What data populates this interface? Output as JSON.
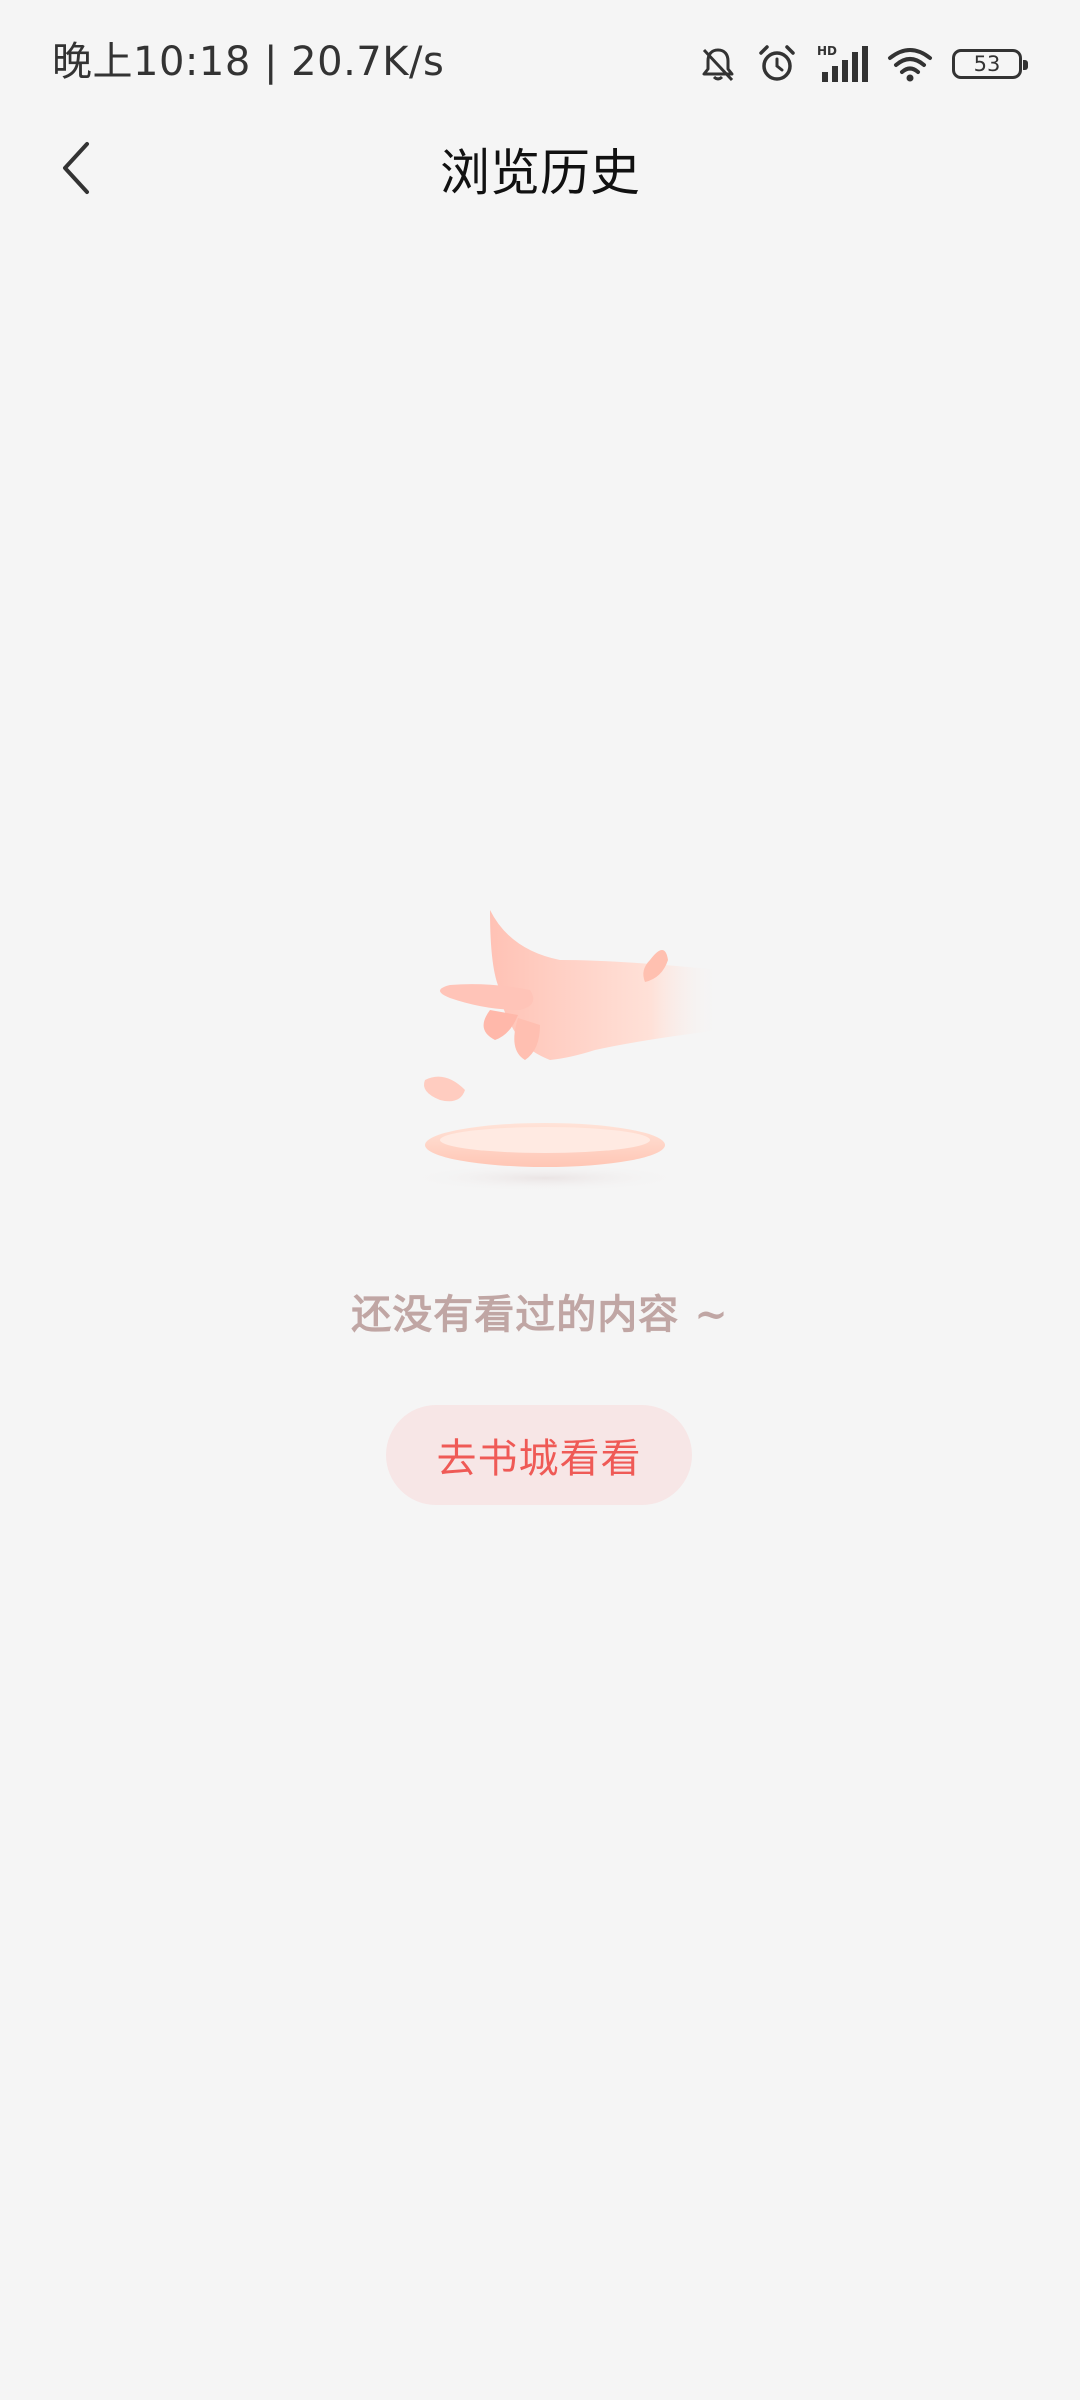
{
  "status_bar": {
    "time_text": "晚上10:18 | 20.7K/s",
    "battery_level": "53",
    "icons": [
      "bell-muted-icon",
      "alarm-icon",
      "hd-signal-icon",
      "wifi-icon",
      "battery-icon"
    ]
  },
  "header": {
    "title": "浏览历史",
    "back_icon": "chevron-left-icon"
  },
  "empty_state": {
    "illustration": "hand-dropping-petals-onto-plate",
    "message": "还没有看过的内容 ~",
    "button_label": "去书城看看"
  },
  "colors": {
    "background": "#f5f5f5",
    "accent": "#ef5a56",
    "button_bg": "#f7e6e6",
    "message": "#c0a6a4"
  }
}
